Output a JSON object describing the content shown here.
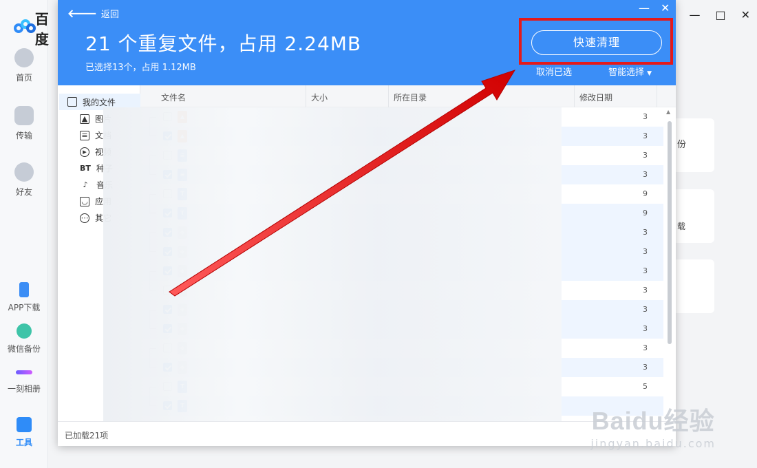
{
  "app": {
    "logo_text": "百度",
    "nav": [
      {
        "label": "首页"
      },
      {
        "label": "传输"
      },
      {
        "label": "好友"
      },
      {
        "label": "APP下载"
      },
      {
        "label": "微信备份"
      },
      {
        "label": "一刻相册"
      },
      {
        "label": "工具"
      }
    ],
    "bg_snippets": [
      "份",
      "载"
    ]
  },
  "dialog": {
    "back_label": "返回",
    "title": "21 个重复文件，占用 2.24MB",
    "subtitle": "已选择13个，占用 1.12MB",
    "quick_clean_label": "快速清理",
    "cancel_selection_label": "取消已选",
    "smart_select_label": "智能选择",
    "minimize_label": "—",
    "close_label": "✕"
  },
  "sidebar": {
    "root": "我的文件",
    "items": [
      {
        "label": "图片",
        "icon": "image-icon"
      },
      {
        "label": "文档",
        "icon": "document-icon"
      },
      {
        "label": "视频",
        "icon": "video-icon"
      },
      {
        "label": "种子",
        "icon": "bt-icon"
      },
      {
        "label": "音乐",
        "icon": "music-icon"
      },
      {
        "label": "应用",
        "icon": "app-icon"
      },
      {
        "label": "其它",
        "icon": "other-icon"
      }
    ],
    "bt_glyph": "BT"
  },
  "table": {
    "columns": [
      "文件名",
      "大小",
      "所在目录",
      "修改日期"
    ],
    "rows": [
      {
        "checked": false,
        "type": "img",
        "date": "3"
      },
      {
        "checked": true,
        "type": "img",
        "date": "3"
      },
      {
        "checked": false,
        "type": "doc",
        "date": "3"
      },
      {
        "checked": true,
        "type": "doc",
        "date": "3"
      },
      {
        "checked": false,
        "type": "txt",
        "date": "9"
      },
      {
        "checked": true,
        "type": "txt",
        "date": "9"
      },
      {
        "checked": true,
        "type": "unk",
        "date": "3"
      },
      {
        "checked": true,
        "type": "unk",
        "date": "3"
      },
      {
        "checked": true,
        "type": "unk",
        "date": "3"
      },
      {
        "checked": false,
        "type": "unk",
        "date": "3"
      },
      {
        "checked": true,
        "type": "unk",
        "date": "3"
      },
      {
        "checked": true,
        "type": "unk",
        "date": "3"
      },
      {
        "checked": false,
        "type": "unk",
        "date": "3"
      },
      {
        "checked": true,
        "type": "unk",
        "date": "3"
      },
      {
        "checked": false,
        "type": "txt",
        "date": "5"
      },
      {
        "checked": true,
        "type": "txt",
        "date": ""
      }
    ],
    "txt_glyph": "T"
  },
  "footer": {
    "loaded_text": "已加载21项"
  },
  "watermark": {
    "main": "Baidu经验",
    "sub": "jingyan.baidu.com"
  },
  "colors": {
    "header_blue": "#3b8ef7",
    "accent": "#2f8cf8",
    "highlight_red": "#e41a1a"
  }
}
